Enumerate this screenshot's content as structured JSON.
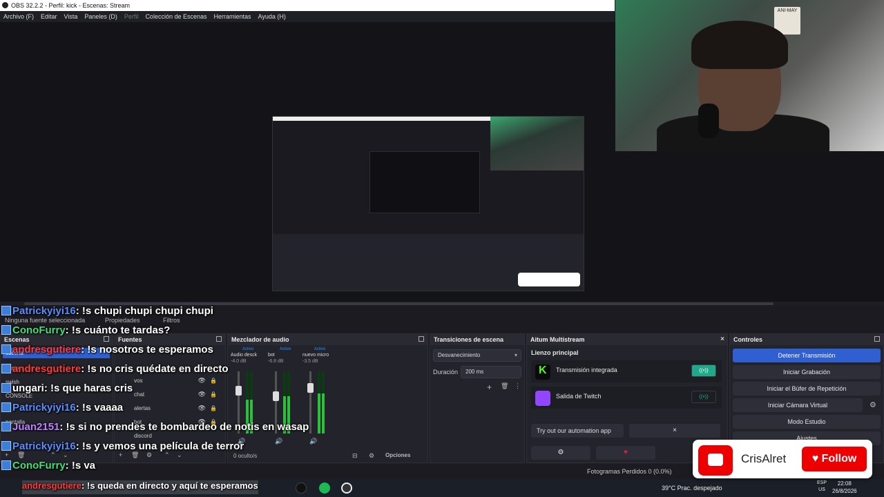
{
  "window": {
    "title": "OBS 32.2.2 - Perfil: kick - Escenas: Stream"
  },
  "menu": [
    "Archivo (F)",
    "Editar",
    "Vista",
    "Paneles (D)",
    "Perfil",
    "Colección de Escenas",
    "Herramientas",
    "Ayuda (H)"
  ],
  "status_top": {
    "no_source": "Ninguna fuente seleccionada",
    "properties": "Propiedades",
    "filters": "Filtros"
  },
  "docks": {
    "scenes": {
      "title": "Escenas",
      "items": [
        "escena",
        "camara con a",
        "swish",
        "CONSOLE",
        "pantalla"
      ]
    },
    "sources": {
      "title": "Fuentes",
      "items": [
        "vos",
        "chat",
        "alertas",
        "bot",
        "discord"
      ]
    },
    "mixer": {
      "title": "Mezclador de audio",
      "channels": [
        {
          "active": "Activo",
          "name": "Audio desck",
          "db": "-4.0 dB",
          "level": 0.55,
          "fader": 0.72
        },
        {
          "active": "Activo",
          "name": "bot",
          "db": "-6.8 dB",
          "level": 0.6,
          "fader": 0.62
        },
        {
          "active": "Activo",
          "name": "nuevo micro",
          "db": "-3.5 dB",
          "level": 0.65,
          "fader": 0.78
        }
      ],
      "hidden": "0 oculto/s",
      "options": "Opciones"
    },
    "transitions": {
      "title": "Transiciones de escena",
      "selected": "Desvanecimiento",
      "duration_label": "Duración",
      "duration_value": "200 ms"
    },
    "aitum": {
      "title": "Aitum Multistream",
      "section": "Lienzo principal",
      "rows": [
        {
          "label": "Transmisión integrada",
          "color": "#53fc18",
          "toggle": "((•))"
        },
        {
          "label": "Salida de Twitch",
          "color": "#9146ff",
          "toggle": "((•))"
        }
      ],
      "try_label": "Try out our automation app",
      "close": "×"
    },
    "controls": {
      "title": "Controles",
      "buttons": [
        "Detener Transmisión",
        "Iniciar Grabación",
        "Iniciar el Búfer de Repetición",
        "Iniciar Cámara Virtual",
        "Modo Estudio",
        "Ajustes"
      ]
    }
  },
  "chat": [
    {
      "user": "Patrickyiyi16",
      "color": "blue",
      "msg": ": !s chupi chupi chupi chupi"
    },
    {
      "user": "ConoFurry",
      "color": "green",
      "msg": ": !s cuánto te tardas?"
    },
    {
      "user": "andresgutiere",
      "color": "red",
      "msg": ": !s nosotros te esperamos"
    },
    {
      "user": "andresgutiere",
      "color": "red",
      "msg": ": !s no cris quédate en directo"
    },
    {
      "user": "ungari",
      "color": "white",
      "msg": ": !s que haras cris"
    },
    {
      "user": "Patrickyiyi16",
      "color": "blue",
      "msg": ": !s vaaaa"
    },
    {
      "user": "Juan2151",
      "color": "purple",
      "msg": ": !s si no prendes te bombardeo de notis en wasap"
    },
    {
      "user": "Patrickyiyi16",
      "color": "blue",
      "msg": ": !s y vemos una película de terror"
    },
    {
      "user": "ConoFurry",
      "color": "green",
      "msg": ": !s va"
    }
  ],
  "chat_bottom": {
    "user": "andresgutiere",
    "msg": ": !s queda en directo y aquí te esperamos"
  },
  "follow": {
    "name": "CrisAlret",
    "button": "Follow"
  },
  "statusbar": {
    "frames": "Fotogramas Perdidos 0 (0.0%)"
  },
  "taskbar": {
    "weather": "39°C  Prac. despejado",
    "lang": "ESP",
    "region": "US",
    "time": "22:08",
    "date": "26/8/2026"
  },
  "webcam": {
    "poster": "ANI-MAY"
  }
}
